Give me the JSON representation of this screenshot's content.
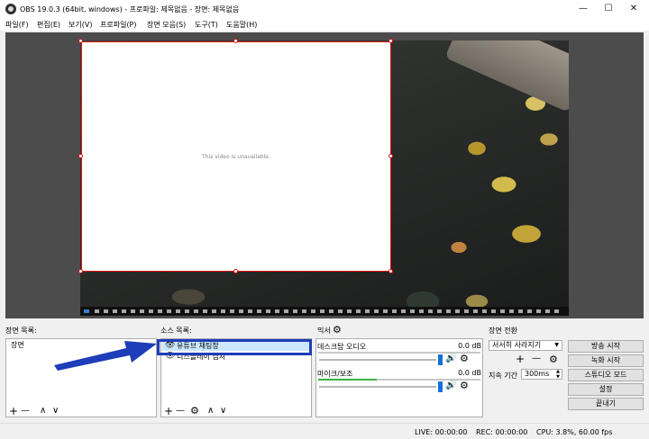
{
  "window": {
    "title": "OBS 19.0.3 (64bit, windows) - 프로파일: 제목없음 - 장면: 제목없음",
    "minimize": "—",
    "maximize": "☐",
    "close": "✕"
  },
  "menu": [
    "파일(F)",
    "편집(E)",
    "보기(V)",
    "프로파일(P)",
    "장면 모음(S)",
    "도구(T)",
    "도움말(H)"
  ],
  "preview": {
    "unavailable_text": "This video is unavailable."
  },
  "scenes": {
    "title": "장면 목록:",
    "items": [
      "장면"
    ],
    "add": "+",
    "remove": "—",
    "up": "∧",
    "down": "∨"
  },
  "sources": {
    "title": "소스 목록:",
    "items": [
      {
        "label": "유튜브 채팅창",
        "selected": true
      },
      {
        "label": "디스플레이 캡쳐",
        "selected": false
      }
    ],
    "add": "+",
    "remove": "—",
    "settings": "⚙",
    "up": "∧",
    "down": "∨"
  },
  "mixer": {
    "title": "믹서",
    "settings": "⚙",
    "channels": [
      {
        "name": "데스크탑 오디오",
        "db": "0.0 dB"
      },
      {
        "name": "마이크/보조",
        "db": "0.0 dB"
      }
    ]
  },
  "transitions": {
    "title": "장면 전환",
    "selected": "서서히 사라지기",
    "add": "+",
    "remove": "—",
    "settings": "⚙",
    "duration_label": "지속 기간",
    "duration_value": "300ms"
  },
  "controls": {
    "start_streaming": "방송 시작",
    "start_recording": "녹화 시작",
    "studio_mode": "스튜디오 모드",
    "settings": "설정",
    "exit": "끝내기"
  },
  "status": {
    "live": "LIVE: 00:00:00",
    "rec": "REC: 00:00:00",
    "cpu": "CPU: 3.8%, 60.00 fps"
  },
  "colors": {
    "selection": "#cce8ff",
    "annotation_arrow": "#1e3db8",
    "source_border": "#e01010",
    "volume_thumb": "#1672d9"
  }
}
